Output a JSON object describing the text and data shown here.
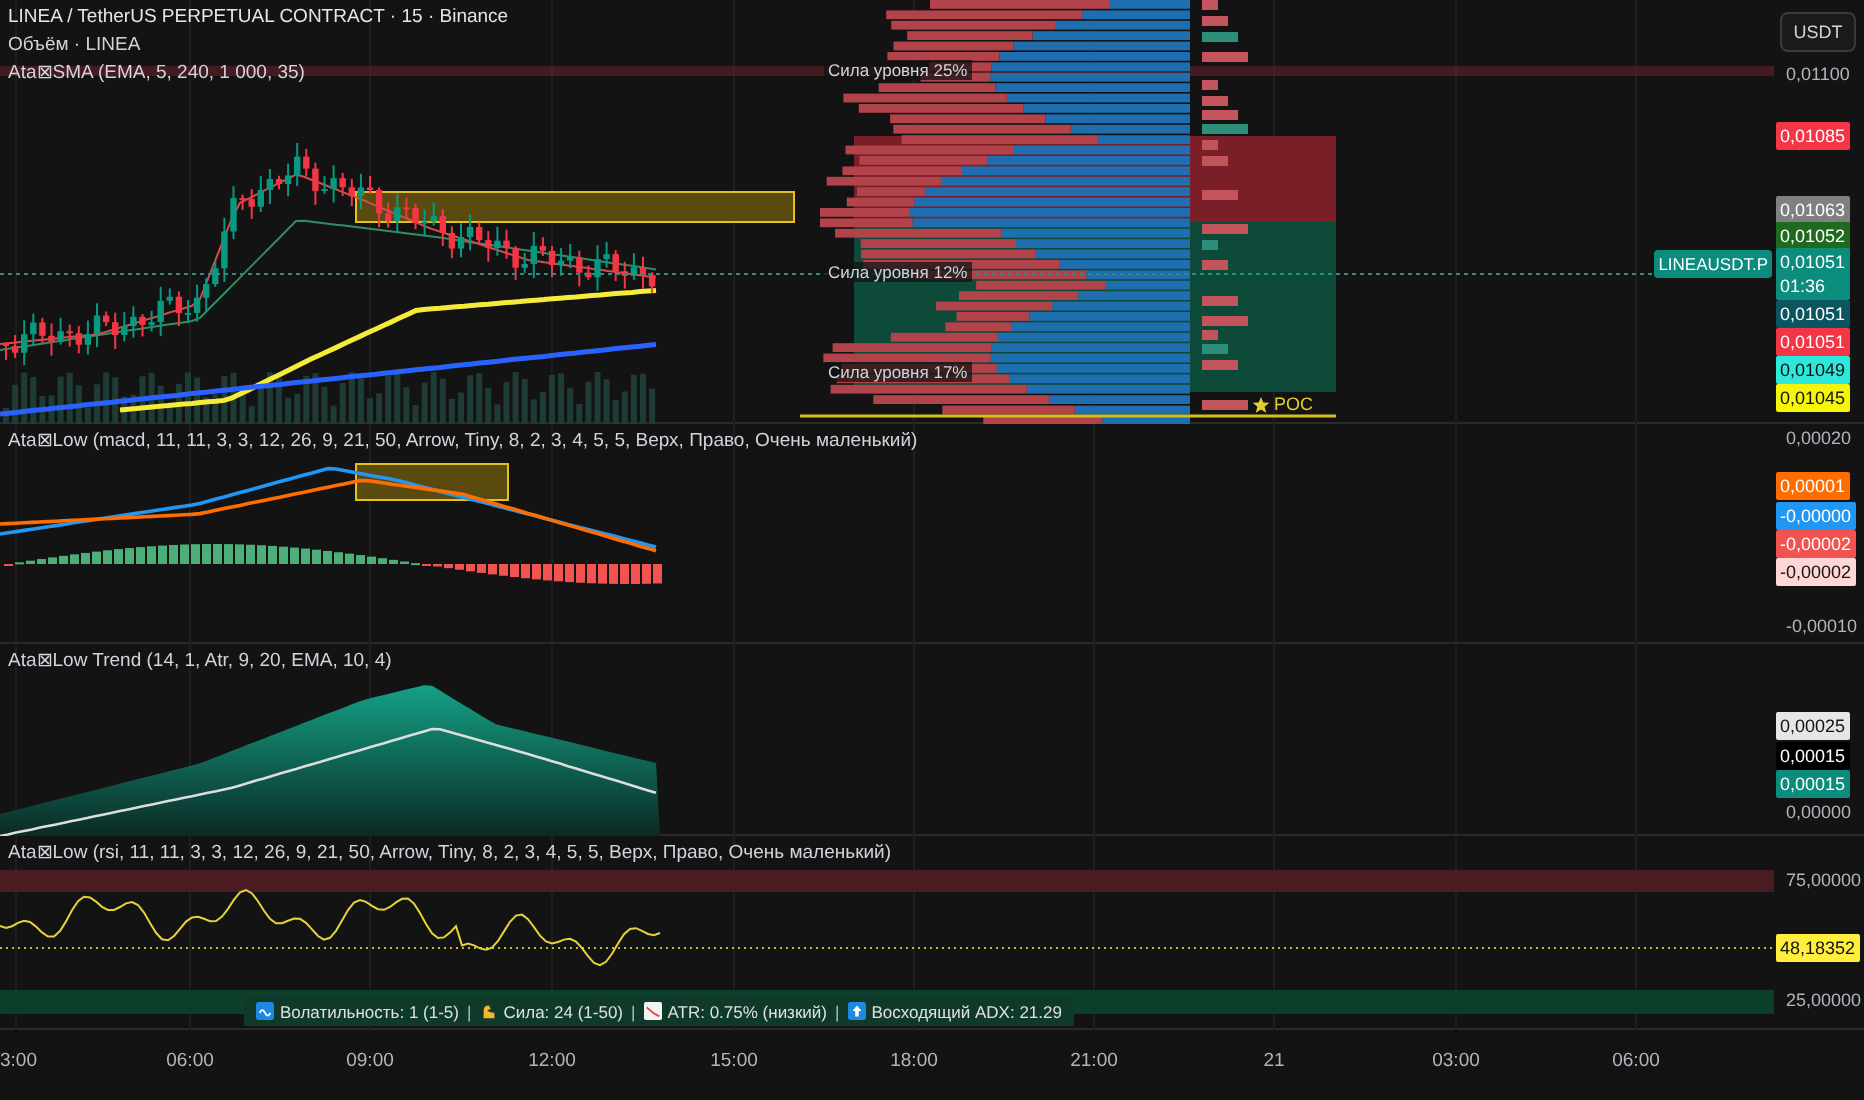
{
  "legend": {
    "title": "LINEA / TetherUS PERPETUAL CONTRACT · 15 · Binance",
    "volume": "Объём · LINEA",
    "indicator": "Ata⊠SMA (EMA, 5, 240, 1 000, 35)"
  },
  "main_pane": {
    "level_labels": [
      "Сила уровня 25%",
      "Сила уровня 12%",
      "Сила уровня 17%"
    ],
    "poc_label": "POC",
    "symbol_tag": "LINEAUSDT.P"
  },
  "macd_pane": {
    "legend": "Ata⊠Low (macd, 11, 11, 3, 3, 12, 26, 9, 21, 50, Arrow, Tiny, 8, 2, 3, 4, 5, 5, Верх, Право, Очень маленький)"
  },
  "trend_pane": {
    "legend": "Ata⊠Low Trend (14, 1, Atr, 9, 20, EMA, 10, 4)"
  },
  "rsi_pane": {
    "legend": "Ata⊠Low (rsi, 11, 11, 3, 3, 12, 26, 9, 21, 50, Arrow, Tiny, 8, 2, 3, 4, 5, 5, Верх, Право, Очень маленький)",
    "status_items": [
      {
        "kind": "stat",
        "text": "Волатильность: 1 (1-5)"
      },
      {
        "kind": "separator",
        "text": "|"
      },
      {
        "kind": "stat",
        "text": "Сила: 24 (1-50)"
      },
      {
        "kind": "separator",
        "text": "|"
      },
      {
        "kind": "stat",
        "text": "ATR: 0.75% (низкий)"
      },
      {
        "kind": "separator",
        "text": "|"
      },
      {
        "kind": "stat",
        "text": "Восходящий ADX: 21.29"
      }
    ]
  },
  "price_scale": {
    "currency_button": "USDT",
    "main": [
      {
        "kind": "plain",
        "text": "0,01100"
      },
      {
        "kind": "badge",
        "text": "0,01085",
        "color": "#f23645"
      },
      {
        "kind": "badge",
        "text": "0,01063",
        "color": "#808080"
      },
      {
        "kind": "badge",
        "text": "0,01052",
        "color": "#1e6b1e"
      },
      {
        "kind": "badge",
        "text": "0,01051",
        "subtext": "01:36",
        "color": "#0b8c7c"
      },
      {
        "kind": "badge",
        "text": "0,01051",
        "color": "#0b5560"
      },
      {
        "kind": "badge",
        "text": "0,01051",
        "color": "#f23645"
      },
      {
        "kind": "badge",
        "text": "0,01049",
        "color": "#2ee8dc"
      },
      {
        "kind": "badge",
        "text": "0,01045",
        "color": "#f5f50a"
      }
    ],
    "macd": [
      {
        "kind": "plain",
        "text": "0,00020"
      },
      {
        "kind": "badge",
        "text": "0,00001",
        "color": "#ff6d00"
      },
      {
        "kind": "badge",
        "text": "-0,00000",
        "color": "#2196f3"
      },
      {
        "kind": "badge",
        "text": "-0,00002",
        "color": "#f05350"
      },
      {
        "kind": "badge",
        "text": "-0,00002",
        "color": "#ffd6d6"
      },
      {
        "kind": "plain",
        "text": "-0,00010"
      }
    ],
    "trend": [
      {
        "kind": "badge",
        "text": "0,00025",
        "color": "#e6e6e6"
      },
      {
        "kind": "badge",
        "text": "0,00015",
        "color": "#000000"
      },
      {
        "kind": "badge",
        "text": "0,00015",
        "color": "#0b8c7c"
      },
      {
        "kind": "plain",
        "text": "0,00000"
      }
    ],
    "rsi": [
      {
        "kind": "plain",
        "text": "75,00000"
      },
      {
        "kind": "badge",
        "text": "48,18352",
        "color": "#ffee3b"
      },
      {
        "kind": "plain",
        "text": "25,00000"
      }
    ]
  },
  "time_axis": [
    "3:00",
    "06:00",
    "09:00",
    "12:00",
    "15:00",
    "18:00",
    "21:00",
    "21",
    "03:00",
    "06:00"
  ]
}
